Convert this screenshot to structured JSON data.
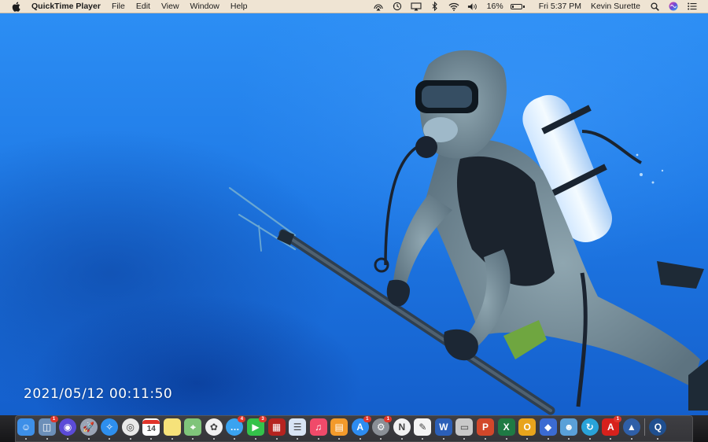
{
  "menubar": {
    "app_name": "QuickTime Player",
    "items": [
      "File",
      "Edit",
      "View",
      "Window",
      "Help"
    ],
    "battery_percent": "16%",
    "battery_level": 0.16,
    "clock": "Fri 5:37 PM",
    "user": "Kevin Surette",
    "status_icons": [
      "airplay-icon",
      "time-machine-icon",
      "display-icon",
      "bluetooth-icon",
      "wifi-icon",
      "volume-icon",
      "battery-icon",
      "spotlight-icon",
      "siri-icon",
      "notification-center-icon"
    ]
  },
  "video": {
    "timestamp": "2021/05/12  00:11:50"
  },
  "dock": {
    "calendar_day": "14",
    "icons": [
      {
        "name": "finder-icon",
        "color": "#3d8fe8"
      },
      {
        "name": "preview-icon",
        "color": "#6c8fb8",
        "badge": "1"
      },
      {
        "name": "siri-icon",
        "color": "#5b4bd8"
      },
      {
        "name": "launchpad-icon",
        "color": "#9aa4b5"
      },
      {
        "name": "safari-icon",
        "color": "#2e8fee"
      },
      {
        "name": "chrome-icon",
        "color": "#e9e9e9"
      },
      {
        "name": "calendar-icon",
        "color": "#ffffff"
      },
      {
        "name": "notes-icon",
        "color": "#f6e27a"
      },
      {
        "name": "maps-icon",
        "color": "#7fc47a"
      },
      {
        "name": "photos-icon",
        "color": "#f1f1f1"
      },
      {
        "name": "messages-icon",
        "color": "#3aa3f0",
        "badge": "4"
      },
      {
        "name": "facetime-icon",
        "color": "#34c24a",
        "badge": "3"
      },
      {
        "name": "photo-booth-icon",
        "color": "#b5231f"
      },
      {
        "name": "news-icon",
        "color": "#d8e4f4"
      },
      {
        "name": "music-icon",
        "color": "#f04a6a"
      },
      {
        "name": "books-icon",
        "color": "#f39a2b"
      },
      {
        "name": "app-store-icon",
        "color": "#2d8cf0",
        "badge": "1"
      },
      {
        "name": "system-preferences-icon",
        "color": "#8a8f96",
        "badge": "1"
      },
      {
        "name": "news-app-icon",
        "color": "#f2f2f2"
      },
      {
        "name": "textedit-icon",
        "color": "#f4f4f4"
      },
      {
        "name": "word-icon",
        "color": "#2b5fb8"
      },
      {
        "name": "quicktime-icon",
        "color": "#c9c9c9"
      },
      {
        "name": "powerpoint-icon",
        "color": "#d2472a"
      },
      {
        "name": "excel-icon",
        "color": "#1f7a44"
      },
      {
        "name": "plex-icon",
        "color": "#e8a41c"
      },
      {
        "name": "anydesk-icon",
        "color": "#3b6bd2"
      },
      {
        "name": "teams-icon",
        "color": "#5aa0d8"
      },
      {
        "name": "pcloud-icon",
        "color": "#29a3d8"
      },
      {
        "name": "acrobat-icon",
        "color": "#d7211c",
        "badge": "1"
      },
      {
        "name": "vpn-icon",
        "color": "#2f5fa8"
      },
      {
        "name": "quicktime-player-icon",
        "color": "#1f4f8f"
      }
    ]
  }
}
